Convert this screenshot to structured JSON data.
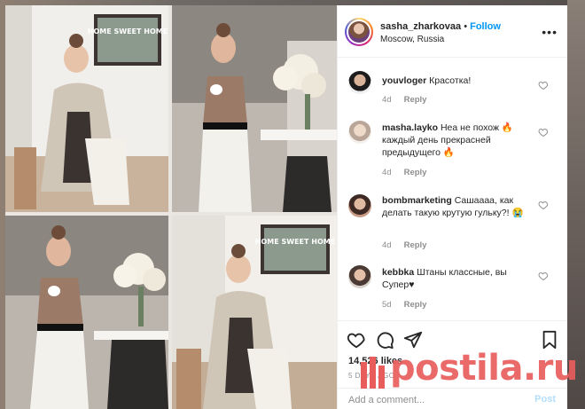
{
  "post": {
    "username": "sasha_zharkovaa",
    "separator": "•",
    "follow_label": "Follow",
    "location": "Moscow, Russia",
    "more_label": "•••"
  },
  "comments": [
    {
      "user": "youvloger",
      "text": "Красотка!",
      "age": "4d",
      "reply_label": "Reply"
    },
    {
      "user": "masha.layko",
      "text": "Неа не похож 🔥 каждый день прекрасней предыдущего 🔥",
      "age": "4d",
      "reply_label": "Reply"
    },
    {
      "user": "bombmarketing",
      "text": "Сашаааа, как делать такую крутую гульку?! 😭",
      "age": "4d",
      "reply_label": "Reply"
    },
    {
      "user": "kebbka",
      "text": "Штаны классные, вы Супер♥",
      "age": "5d",
      "reply_label": "Reply"
    }
  ],
  "actions": {
    "likes": "14,526 likes",
    "time_ago": "5 DAYS AGO",
    "add_comment_placeholder": "Add a comment...",
    "post_label": "Post"
  },
  "photos": {
    "sign_text_1": "HOME SWEET HOME",
    "sign_text_2": "HOME SWEET HOME"
  },
  "watermark": {
    "text": "postila.ru"
  },
  "colors": {
    "link_blue": "#0095f6",
    "watermark_red": "#e85c5c"
  }
}
